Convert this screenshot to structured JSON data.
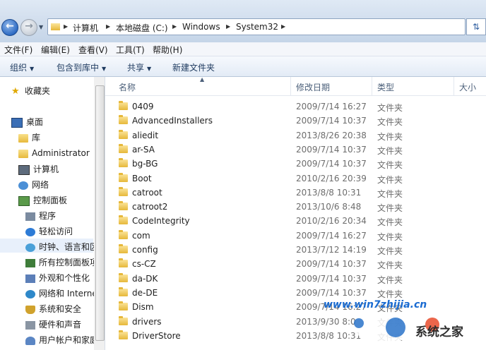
{
  "address": {
    "crumbs": [
      "计算机",
      "本地磁盘 (C:)",
      "Windows",
      "System32"
    ]
  },
  "menu": [
    "文件(F)",
    "编辑(E)",
    "查看(V)",
    "工具(T)",
    "帮助(H)"
  ],
  "toolbar": {
    "organize": "组织",
    "include": "包含到库中",
    "share": "共享",
    "new_folder": "新建文件夹"
  },
  "nav": {
    "favorites": "收藏夹",
    "desktop": "桌面",
    "libraries": "库",
    "administrator": "Administrator",
    "computer": "计算机",
    "network": "网络",
    "control_panel": "控制面板",
    "programs": "程序",
    "ease_access": "轻松访问",
    "clock": "时钟、语言和区",
    "all_items": "所有控制面板项",
    "appearance": "外观和个性化",
    "net_internet": "网络和 Interne",
    "security": "系统和安全",
    "hardware": "硬件和声音",
    "user_accounts": "用户帐户和家庭"
  },
  "columns": {
    "name": "名称",
    "date": "修改日期",
    "type": "类型",
    "size": "大小"
  },
  "files": [
    {
      "name": "0409",
      "date": "2009/7/14 16:27",
      "type": "文件夹"
    },
    {
      "name": "AdvancedInstallers",
      "date": "2009/7/14 10:37",
      "type": "文件夹"
    },
    {
      "name": "aliedit",
      "date": "2013/8/26 20:38",
      "type": "文件夹"
    },
    {
      "name": "ar-SA",
      "date": "2009/7/14 10:37",
      "type": "文件夹"
    },
    {
      "name": "bg-BG",
      "date": "2009/7/14 10:37",
      "type": "文件夹"
    },
    {
      "name": "Boot",
      "date": "2010/2/16 20:39",
      "type": "文件夹"
    },
    {
      "name": "catroot",
      "date": "2013/8/8 10:31",
      "type": "文件夹"
    },
    {
      "name": "catroot2",
      "date": "2013/10/6 8:48",
      "type": "文件夹"
    },
    {
      "name": "CodeIntegrity",
      "date": "2010/2/16 20:34",
      "type": "文件夹"
    },
    {
      "name": "com",
      "date": "2009/7/14 16:27",
      "type": "文件夹"
    },
    {
      "name": "config",
      "date": "2013/7/12 14:19",
      "type": "文件夹"
    },
    {
      "name": "cs-CZ",
      "date": "2009/7/14 10:37",
      "type": "文件夹"
    },
    {
      "name": "da-DK",
      "date": "2009/7/14 10:37",
      "type": "文件夹"
    },
    {
      "name": "de-DE",
      "date": "2009/7/14 10:37",
      "type": "文件夹"
    },
    {
      "name": "Dism",
      "date": "2009/7/14 16:27",
      "type": "文件夹"
    },
    {
      "name": "drivers",
      "date": "2013/9/30 8:0",
      "type": "文件夹"
    },
    {
      "name": "DriverStore",
      "date": "2013/8/8 10:31",
      "type": "文件夹"
    }
  ],
  "watermark": {
    "url": "www.win7zhijia.cn",
    "text": "系统之家"
  }
}
